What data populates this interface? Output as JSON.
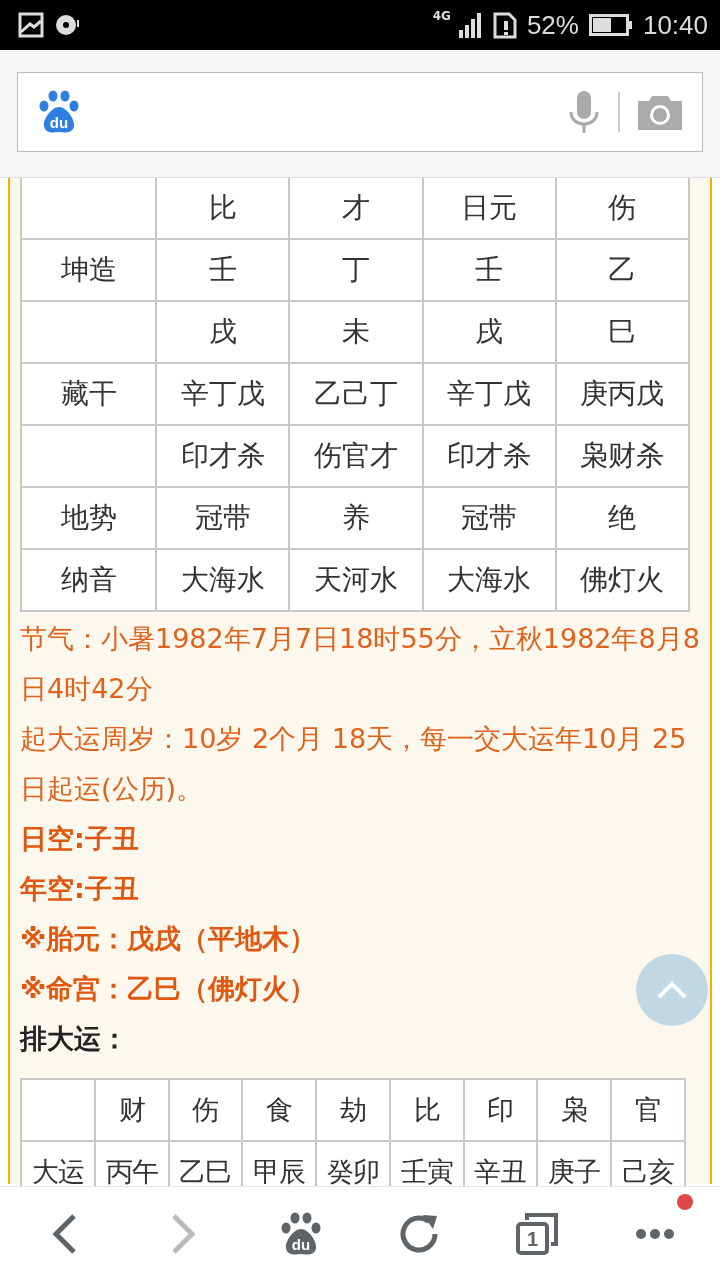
{
  "status_bar": {
    "network": "4G",
    "battery": "52%",
    "time": "10:40"
  },
  "search_bar": {
    "logo_text": "du"
  },
  "bazi_table": {
    "rows": [
      {
        "cells": [
          "比",
          "才",
          "日元",
          "伤"
        ]
      },
      {
        "label": "坤造",
        "cells": [
          "壬",
          "丁",
          "壬",
          "乙"
        ]
      },
      {
        "cells": [
          "戌",
          "未",
          "戌",
          "巳"
        ]
      },
      {
        "label": "藏干",
        "cells": [
          "辛丁戊",
          "乙己丁",
          "辛丁戊",
          "庚丙戊"
        ]
      },
      {
        "cells": [
          "印才杀",
          "伤官才",
          "印才杀",
          "枭财杀"
        ]
      },
      {
        "label": "地势",
        "cells": [
          "冠带",
          "养",
          "冠带",
          "绝"
        ]
      },
      {
        "label": "纳音",
        "cells": [
          "大海水",
          "天河水",
          "大海水",
          "佛灯火"
        ]
      }
    ]
  },
  "notes": [
    {
      "kind": "plain",
      "text": "节气：小暑1982年7月7日18时55分，立秋1982年8月8日4时42分"
    },
    {
      "kind": "plain",
      "text": "起大运周岁：10岁 2个月 18天，每一交大运年10月 25日起运(公历)。"
    },
    {
      "kind": "bold",
      "text": "日空:子丑"
    },
    {
      "kind": "bold",
      "text": "年空:子丑"
    },
    {
      "kind": "bold",
      "text": "※胎元：戊戌（平地木）"
    },
    {
      "kind": "bold",
      "text": "※命宫：乙巳（佛灯火）"
    },
    {
      "kind": "heading",
      "text": "排大运："
    }
  ],
  "dayun_table": {
    "headers": [
      "财",
      "伤",
      "食",
      "劫",
      "比",
      "印",
      "枭",
      "官"
    ],
    "row_label": "大运",
    "cells": [
      "丙午",
      "乙巳",
      "甲辰",
      "癸卯",
      "壬寅",
      "辛丑",
      "庚子",
      "己亥"
    ]
  },
  "nav": {
    "buttons": [
      {
        "kind": "back",
        "disabled": false
      },
      {
        "kind": "forward",
        "disabled": true
      },
      {
        "kind": "home",
        "label": "du"
      },
      {
        "kind": "refresh"
      },
      {
        "kind": "tabs",
        "label": "1"
      },
      {
        "kind": "more",
        "badge": true
      }
    ]
  }
}
